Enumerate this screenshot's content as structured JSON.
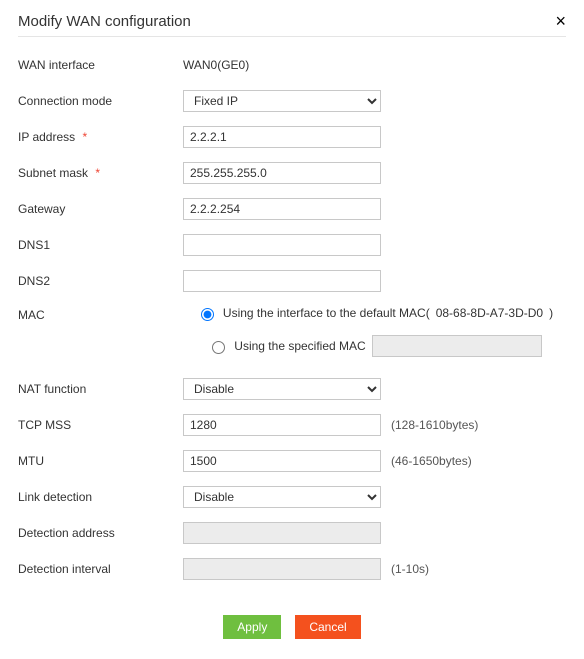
{
  "header": {
    "title": "Modify WAN configuration",
    "close_glyph": "×"
  },
  "labels": {
    "wan_interface": "WAN interface",
    "connection_mode": "Connection mode",
    "ip_address": "IP address",
    "subnet_mask": "Subnet mask",
    "gateway": "Gateway",
    "dns1": "DNS1",
    "dns2": "DNS2",
    "mac": "MAC",
    "nat_function": "NAT function",
    "tcp_mss": "TCP MSS",
    "mtu": "MTU",
    "link_detection": "Link detection",
    "detection_address": "Detection address",
    "detection_interval": "Detection interval"
  },
  "values": {
    "wan_interface": "WAN0(GE0)",
    "connection_mode": "Fixed IP",
    "ip_address": "2.2.2.1",
    "subnet_mask": "255.255.255.0",
    "gateway": "2.2.2.254",
    "dns1": "",
    "dns2": "",
    "mac_default_text_prefix": "Using the interface to the default MAC( ",
    "mac_default_value": "08-68-8D-A7-3D-D0",
    "mac_default_text_suffix": " )",
    "mac_specified_label": "Using the specified MAC",
    "mac_specified_value": "",
    "nat_function": "Disable",
    "tcp_mss": "1280",
    "mtu": "1500",
    "link_detection": "Disable",
    "detection_address": "",
    "detection_interval": ""
  },
  "hints": {
    "tcp_mss": "(128-1610bytes)",
    "mtu": "(46-1650bytes)",
    "detection_interval": "(1-10s)"
  },
  "required_marker": "*",
  "actions": {
    "apply": "Apply",
    "cancel": "Cancel"
  }
}
